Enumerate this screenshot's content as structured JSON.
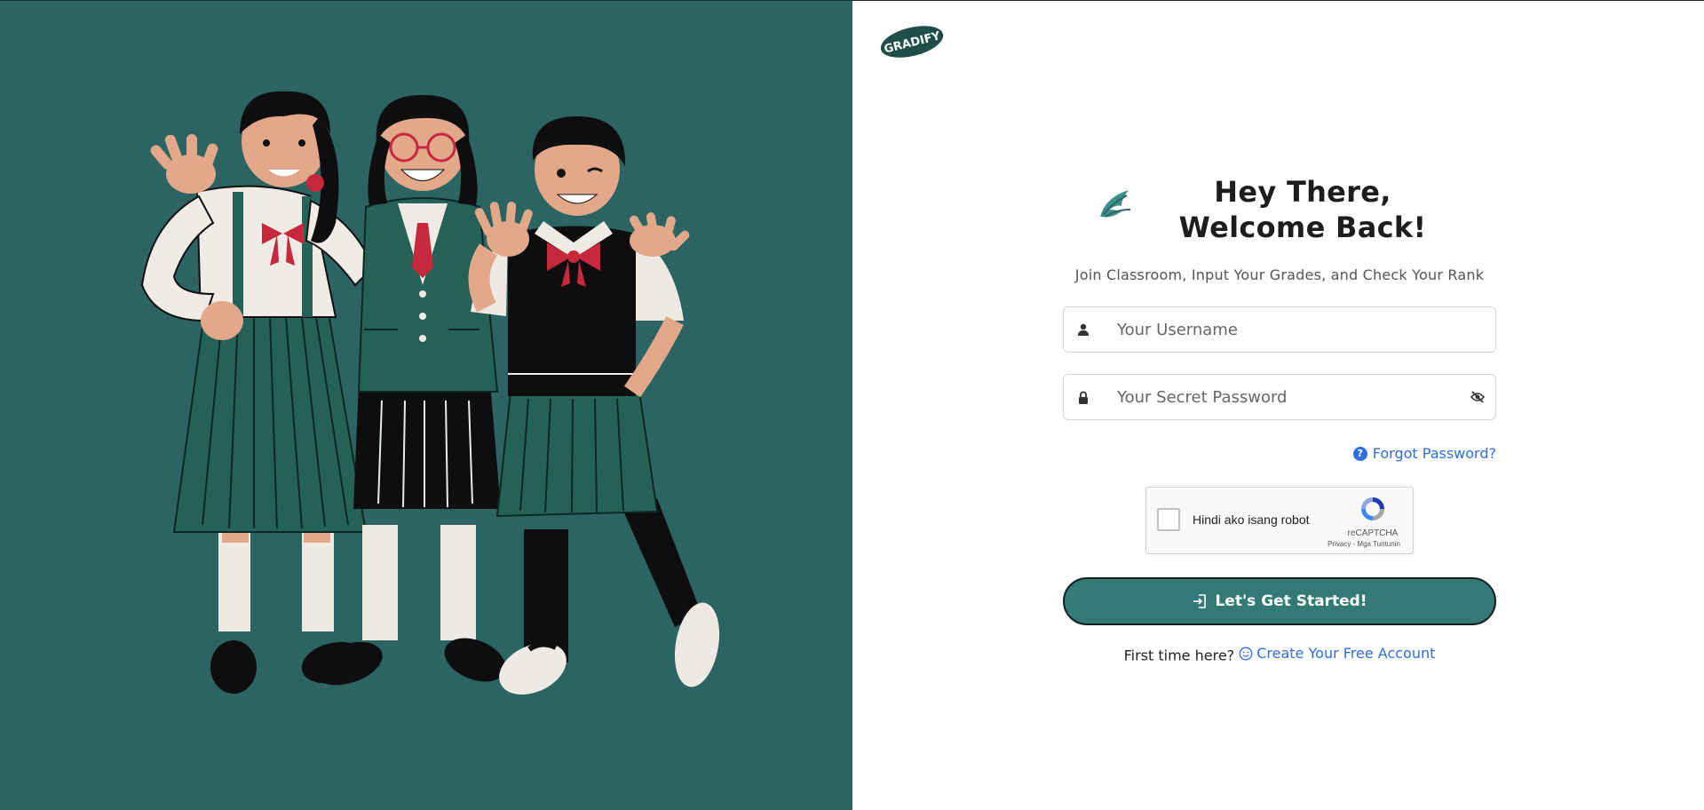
{
  "brand": {
    "logo_text": "GRADIFY"
  },
  "login": {
    "title": "Hey There, Welcome Back!",
    "subtitle": "Join Classroom, Input Your Grades, and Check Your Rank",
    "username_placeholder": "Your Username",
    "password_placeholder": "Your Secret Password",
    "forgot_label": "Forgot Password?",
    "captcha": {
      "label": "Hindi ako isang robot",
      "brand": "reCAPTCHA",
      "links": "Privacy - Mga Tuntunin"
    },
    "submit_label": "Let's Get Started!",
    "signup_prompt": "First time here?",
    "signup_link": "Create Your Free Account"
  },
  "icons": {
    "username": "user-icon",
    "password": "lock-icon",
    "toggle_password": "eye-slash-icon",
    "forgot": "question-circle-icon",
    "submit": "sign-in-icon",
    "signup": "smile-icon"
  },
  "colors": {
    "hero_background": "#2c6463",
    "button": "#337a77",
    "link": "#2f6fe0"
  }
}
